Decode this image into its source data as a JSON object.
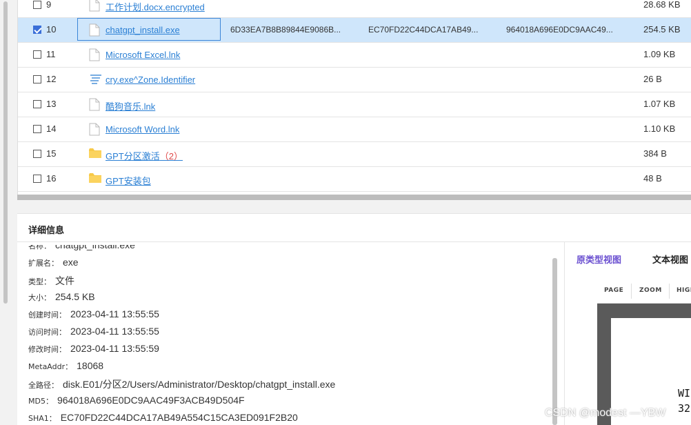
{
  "files": [
    {
      "num": "9",
      "name": "工作计划.docx.encrypted",
      "count": "",
      "icon": "file-icon",
      "md5": "",
      "sha1": "",
      "sha256": "",
      "size": "28.68 KB",
      "checked": false,
      "selected": false
    },
    {
      "num": "10",
      "name": "chatgpt_install.exe",
      "count": "",
      "icon": "file-icon",
      "md5": "6D33EA7B8B89844E9086B...",
      "sha1": "EC70FD22C44DCA17AB49...",
      "sha256": "964018A696E0DC9AAC49...",
      "size": "254.5 KB",
      "checked": true,
      "selected": true
    },
    {
      "num": "11",
      "name": "Microsoft Excel.lnk",
      "count": "",
      "icon": "file-icon",
      "md5": "",
      "sha1": "",
      "sha256": "",
      "size": "1.09 KB",
      "checked": false,
      "selected": false
    },
    {
      "num": "12",
      "name": "cry.exe^Zone.Identifier",
      "count": "",
      "icon": "stream-icon",
      "md5": "",
      "sha1": "",
      "sha256": "",
      "size": "26 B",
      "checked": false,
      "selected": false
    },
    {
      "num": "13",
      "name": "酷狗音乐.lnk",
      "count": "",
      "icon": "file-icon",
      "md5": "",
      "sha1": "",
      "sha256": "",
      "size": "1.07 KB",
      "checked": false,
      "selected": false
    },
    {
      "num": "14",
      "name": "Microsoft Word.lnk",
      "count": "",
      "icon": "file-icon",
      "md5": "",
      "sha1": "",
      "sha256": "",
      "size": "1.10 KB",
      "checked": false,
      "selected": false
    },
    {
      "num": "15",
      "name": "GPT分区激活",
      "count": "（2）",
      "icon": "folder-icon",
      "md5": "",
      "sha1": "",
      "sha256": "",
      "size": "384 B",
      "checked": false,
      "selected": false
    },
    {
      "num": "16",
      "name": "GPT安装包",
      "count": "",
      "icon": "folder-icon",
      "md5": "",
      "sha1": "",
      "sha256": "",
      "size": "48 B",
      "checked": false,
      "selected": false
    }
  ],
  "detail": {
    "title": "详细信息",
    "props": [
      {
        "key": "名称：",
        "value": "chatgpt_install.exe"
      },
      {
        "key": "扩展名：",
        "value": "exe"
      },
      {
        "key": "类型：",
        "value": "文件"
      },
      {
        "key": "大小：",
        "value": "254.5 KB"
      },
      {
        "key": "创建时间：",
        "value": "2023-04-11 13:55:55"
      },
      {
        "key": "访问时间：",
        "value": "2023-04-11 13:55:55"
      },
      {
        "key": "修改时间：",
        "value": "2023-04-11 13:55:59"
      },
      {
        "key": "MetaAddr：",
        "value": "18068"
      },
      {
        "key": "全路径：",
        "value": "disk.E01/分区2/Users/Administrator/Desktop/chatgpt_install.exe"
      },
      {
        "key": "MD5：",
        "value": "964018A696E0DC9AAC49F3ACB49D504F"
      },
      {
        "key": "SHA1：",
        "value": "EC70FD22C44DCA17AB49A554C15CA3ED091F2B20"
      }
    ]
  },
  "preview": {
    "tab_prototype": "原类型视图",
    "tab_text": "文本视图",
    "toolbar": {
      "page": "PAGE",
      "zoom": "ZOOM",
      "high": "HIGH"
    },
    "page_line1": "WI",
    "page_line2": "32"
  },
  "watermark": "CSDN @modest —YBW",
  "colors": {
    "link": "#2a7fd4",
    "selected_row": "#cfe6fb",
    "checkbox": "#3a6fd8",
    "tab_active": "#6a4fd0",
    "count_red": "#e04848"
  }
}
